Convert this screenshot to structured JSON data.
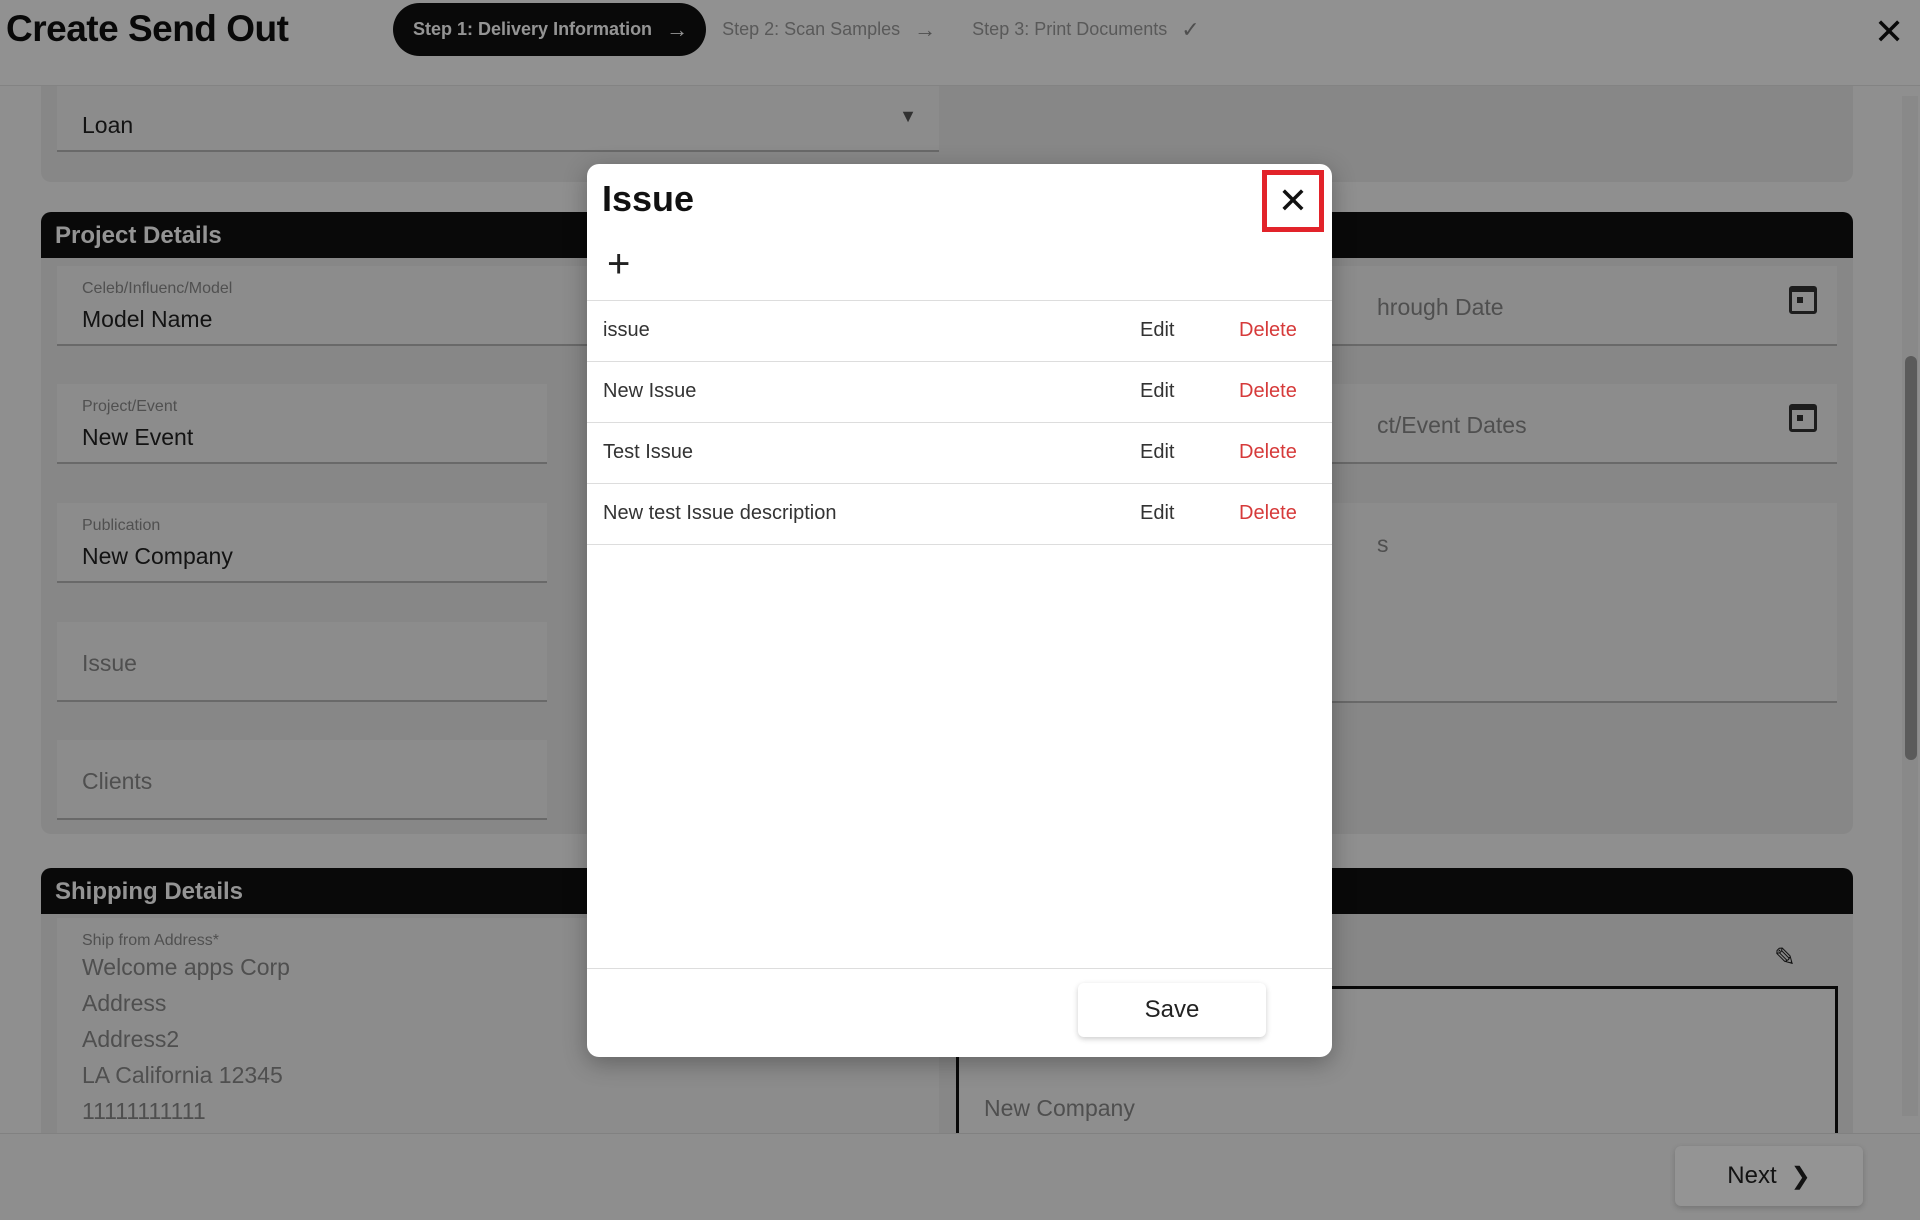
{
  "header": {
    "title": "Create Send Out",
    "steps": [
      {
        "label": "Step 1: Delivery Information",
        "state": "active"
      },
      {
        "label": "Step 2: Scan Samples",
        "state": "upcoming"
      },
      {
        "label": "Step 3: Print Documents",
        "state": "upcoming"
      }
    ]
  },
  "form": {
    "loan_field": {
      "value": "Loan"
    },
    "project_details": {
      "title": "Project Details",
      "celeb": {
        "label": "Celeb/Influenc/Model",
        "value": "Model Name"
      },
      "project_event": {
        "label": "Project/Event",
        "value": "New Event"
      },
      "publication": {
        "label": "Publication",
        "value": "New Company"
      },
      "issue": {
        "placeholder": "Issue"
      },
      "clients": {
        "placeholder": "Clients"
      },
      "through_date": {
        "placeholder": "hrough Date"
      },
      "event_dates": {
        "placeholder": "ct/Event Dates"
      },
      "notes_partial": {
        "text": "s"
      }
    },
    "shipping_details": {
      "title": "Shipping Details",
      "ship_from": {
        "label": "Ship from Address*",
        "lines": [
          "Welcome apps Corp",
          "Address",
          "Address2",
          "LA California 12345",
          "11111111111"
        ]
      },
      "ship_to_partial": {
        "text": "New Company"
      }
    }
  },
  "footer": {
    "next_label": "Next"
  },
  "modal": {
    "title": "Issue",
    "items": [
      {
        "text": "issue",
        "edit": "Edit",
        "delete": "Delete"
      },
      {
        "text": "New Issue",
        "edit": "Edit",
        "delete": "Delete"
      },
      {
        "text": "Test Issue",
        "edit": "Edit",
        "delete": "Delete"
      },
      {
        "text": "New test Issue description",
        "edit": "Edit",
        "delete": "Delete"
      }
    ],
    "save_label": "Save"
  },
  "icons": {
    "step_arrow": "arrow-right-icon",
    "step_check": "check-icon",
    "close": "close-icon",
    "add": "plus-icon",
    "calendar": "calendar-icon",
    "dropdown": "chevron-down-icon",
    "edit": "pencil-icon",
    "next": "chevron-right-icon"
  },
  "colors": {
    "highlight_box": "#e2232a",
    "delete_text": "#d63a3a",
    "header_bar": "#111111"
  }
}
